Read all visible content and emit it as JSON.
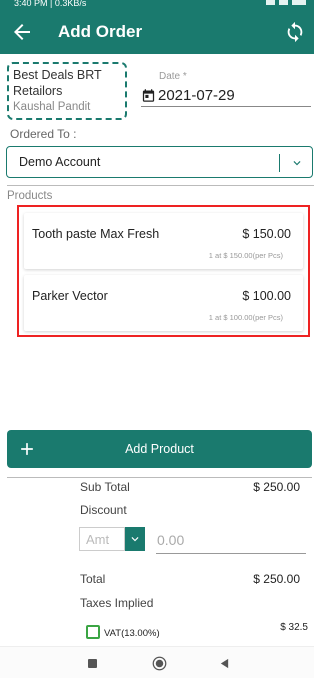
{
  "status_bar": {
    "text": "3:40 PM | 0.3KB/s"
  },
  "app_bar": {
    "title": "Add Order",
    "back_icon": "back-arrow-icon",
    "sync_icon": "sync-icon"
  },
  "customer": {
    "name": "Best Deals BRT Retailors",
    "person": "Kaushal Pandit"
  },
  "date": {
    "label": "Date *",
    "value": "2021-07-29",
    "icon": "calendar-icon"
  },
  "ordered_to": {
    "label": "Ordered To :",
    "value": "Demo Account",
    "icon": "chevron-down-icon"
  },
  "products": {
    "label": "Products",
    "items": [
      {
        "name": "Tooth paste Max Fresh",
        "amount": "$ 150.00",
        "detail": "1 at $ 150.00(per Pcs)"
      },
      {
        "name": "Parker Vector",
        "amount": "$ 100.00",
        "detail": "1 at $ 100.00(per Pcs)"
      }
    ]
  },
  "add_product": {
    "label": "Add Product",
    "icon": "plus-icon"
  },
  "summary": {
    "sub_total_label": "Sub Total",
    "sub_total_value": "$ 250.00",
    "discount_label": "Discount",
    "discount_type": "Amt",
    "discount_placeholder": "0.00",
    "total_label": "Total",
    "total_value": "$ 250.00",
    "taxes_label": "Taxes Implied",
    "vat_label": "VAT(13.00%)",
    "vat_value": "$ 32.5"
  },
  "colors": {
    "primary": "#1a7a6e",
    "highlight": "#ee2222",
    "checkbox": "#3ba544"
  },
  "nav_bar": {
    "icons": [
      "square-icon",
      "home-circle-icon",
      "back-triangle-icon"
    ]
  }
}
